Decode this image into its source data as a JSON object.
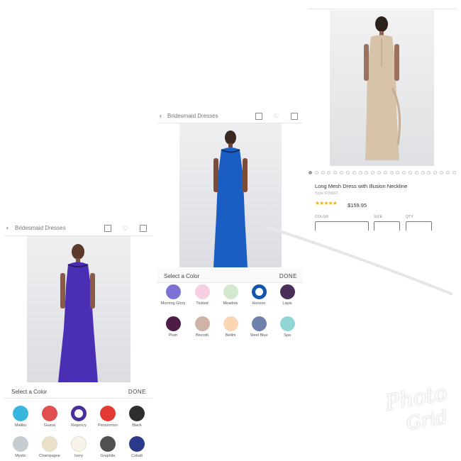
{
  "panel_a": {
    "breadcrumb": "Bridesmaid Dresses",
    "select_color_title": "Select a Color",
    "done_label": "DONE",
    "swatches": [
      {
        "name": "Malibu",
        "color": "#38b6e0"
      },
      {
        "name": "Guava",
        "color": "#e05050"
      },
      {
        "name": "Regency",
        "color": "#4a2c9c",
        "selected": true
      },
      {
        "name": "Persimmon",
        "color": "#e23a32"
      },
      {
        "name": "Black",
        "color": "#2e2e2e"
      },
      {
        "name": "Mystic",
        "color": "#c6ccd2"
      },
      {
        "name": "Champagne",
        "color": "#ebe1c8"
      },
      {
        "name": "Ivory",
        "color": "#f8f3e8"
      },
      {
        "name": "Graphite",
        "color": "#505052"
      },
      {
        "name": "Cobalt",
        "color": "#2b3a8a"
      }
    ],
    "dress_color": "#4a2fb4"
  },
  "panel_b": {
    "breadcrumb": "Bridesmaid Dresses",
    "select_color_title": "Select a Color",
    "done_label": "DONE",
    "swatches": [
      {
        "name": "Morning Glory",
        "color": "#7c72d6"
      },
      {
        "name": "Tickled",
        "color": "#f6cfe2"
      },
      {
        "name": "Meadow",
        "color": "#d3e8cc"
      },
      {
        "name": "Horizon",
        "color": "#0e56b0",
        "selected": true
      },
      {
        "name": "Lapis",
        "color": "#4a2e57"
      },
      {
        "name": "Plum",
        "color": "#4d1d46"
      },
      {
        "name": "Biscotti",
        "color": "#cfb3a6"
      },
      {
        "name": "Bellini",
        "color": "#fbd6b4"
      },
      {
        "name": "Steel Blue",
        "color": "#6f82ad"
      },
      {
        "name": "Spa",
        "color": "#8fd6d4"
      }
    ],
    "dress_color": "#1a5ec4"
  },
  "panel_c": {
    "product_name": "Long Mesh Dress with Illusion Neckline",
    "style_number": "Style F15662",
    "rating_stars": "★★★★★",
    "price": "$159.95",
    "color_label": "COLOR",
    "size_label": "SIZE",
    "qty_label": "QTY",
    "dress_color": "#d7c2aa"
  },
  "watermark": {
    "line1": "Photo",
    "line2": "Grid"
  }
}
